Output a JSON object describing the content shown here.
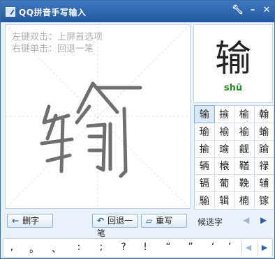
{
  "window": {
    "title": "QQ拼音手写输入"
  },
  "titlebar_icons": [
    "wrench-icon",
    "minimize-icon",
    "close-icon"
  ],
  "canvas": {
    "hint_line1": "左键双击：上屏首选项",
    "hint_line2": "右键单击：回退一笔"
  },
  "buttons": {
    "delete": "删字",
    "undo": "回退一笔",
    "rewrite": "重写"
  },
  "preview": {
    "character": "输",
    "pinyin": "shū"
  },
  "candidates": [
    "输",
    "揄",
    "榆",
    "翰",
    "瑜",
    "褕",
    "褕",
    "蝓",
    "揄",
    "瑜",
    "觎",
    "踰",
    "辆",
    "榱",
    "鞧",
    "禄",
    "镉",
    "葡",
    "鞔",
    "辅",
    "騟",
    "辑",
    "楠",
    "镓"
  ],
  "candidate_label": "候选字",
  "punctuation": [
    ",",
    "。",
    "、",
    ":",
    ";",
    "?",
    "!",
    "“",
    "”",
    "‘",
    "’"
  ],
  "colors": {
    "titlebar": "#2a62a8",
    "pinyin": "#2c8a2c",
    "window_bg": "#e9f1fa"
  }
}
